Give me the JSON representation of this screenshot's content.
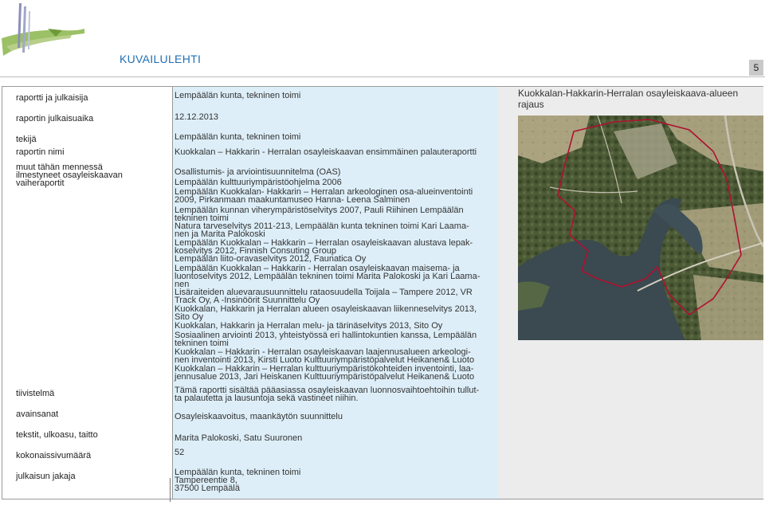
{
  "header": {
    "title": "KUVAILULEHTI",
    "page_number": "5"
  },
  "rows": [
    {
      "label": "raportti ja julkaisija",
      "value": "Lempäälän kunta, tekninen toimi"
    },
    {
      "label": "raportin julkaisuaika",
      "value": "12.12.2013"
    },
    {
      "label": "tekijä",
      "value": "Lempäälän kunta, tekninen toimi"
    },
    {
      "label": "raportin nimi",
      "value": "Kuokkalan – Hakkarin - Herralan osayleiskaavan ensimmäinen palauteraportti"
    },
    {
      "label": "muut tähän mennessä\nilmestyneet osayleiskaavan\nvaiheraportit",
      "value": ""
    },
    {
      "label": "tiivistelmä",
      "value": "Tämä raportti sisältää pääasiassa osayleiskaavan luonnosvaihtoehtoihin tullut-\nta palautetta ja lausuntoja sekä vastineet niihin."
    },
    {
      "label": "avainsanat",
      "value": "Osayleiskaavoitus, maankäytön suunnittelu"
    },
    {
      "label": "tekstit, ulkoasu, taitto",
      "value": "Marita Palokoski, Satu Suuronen"
    },
    {
      "label": "kokonaissivumäärä",
      "value": "52"
    },
    {
      "label": "julkaisun jakaja",
      "value": "Lempäälän kunta, tekninen toimi\nTampereentie 8,\n37500 Lempäälä"
    }
  ],
  "reports": [
    "Osallistumis- ja arviointisuunnitelma (OAS)",
    "Lempäälän kulttuuriympäristöohjelma 2006",
    "Lempäälän Kuokkalan- Hakkarin – Herralan arkeologinen osa-alueinventointi\n2009, Pirkanmaan maakuntamuseo Hanna- Leena Salminen",
    "Lempäälän kunnan viherympäristöselvitys 2007, Pauli Riihinen Lempäälän\ntekninen toimi",
    "Natura tarveselvitys 2011-213, Lempäälän kunta tekninen toimi Kari Laama-\nnen ja Marita Palokoski",
    "Lempäälän Kuokkalan – Hakkarin – Herralan osayleiskaavan alustava lepak-\nkoselvitys 2012, Finnish Consuting Group",
    "Lempäälän liito-oravaselvitys 2012, Faunatica Oy",
    "Lempäälän Kuokkalan – Hakkarin - Herralan osayleiskaavan maisema- ja\nluontoselvitys 2012, Lempäälän tekninen toimi Marita Palokoski ja Kari Laama-\nnen",
    "Lisäraiteiden aluevarausuunnittelu rataosuudella Toijala – Tampere 2012, VR\nTrack Oy, A -Insinöörit Suunnittelu Oy",
    "Kuokkalan, Hakkarin ja Herralan alueen osayleiskaavan liikenneselvitys 2013,\nSito Oy",
    "Kuokkalan, Hakkarin ja Herralan melu- ja tärinäselvitys 2013, Sito Oy",
    "Sosiaalinen arviointi 2013, yhteistyössä eri hallintokuntien kanssa, Lempäälän\ntekninen toimi",
    "Kuokkalan – Hakkarin - Herralan osayleiskaavan laajennusalueen arkeologi-\nnen inventointi 2013, Kirsti Luoto Kulttuuriympäristöpalvelut Heikanen& Luoto",
    "Kuokkalan – Hakkarin – Herralan kulttuuriympäristökohteiden inventointi, laa-\njennusalue 2013, Jari Heiskanen Kulttuuriympäristöpalvelut Heikanen& Luoto"
  ],
  "map": {
    "title": "Kuokkalan-Hakkarin-Herralan osayleiskaava-alueen rajaus",
    "boundary_color": "#b01030",
    "water_color": "#3a4a50"
  }
}
